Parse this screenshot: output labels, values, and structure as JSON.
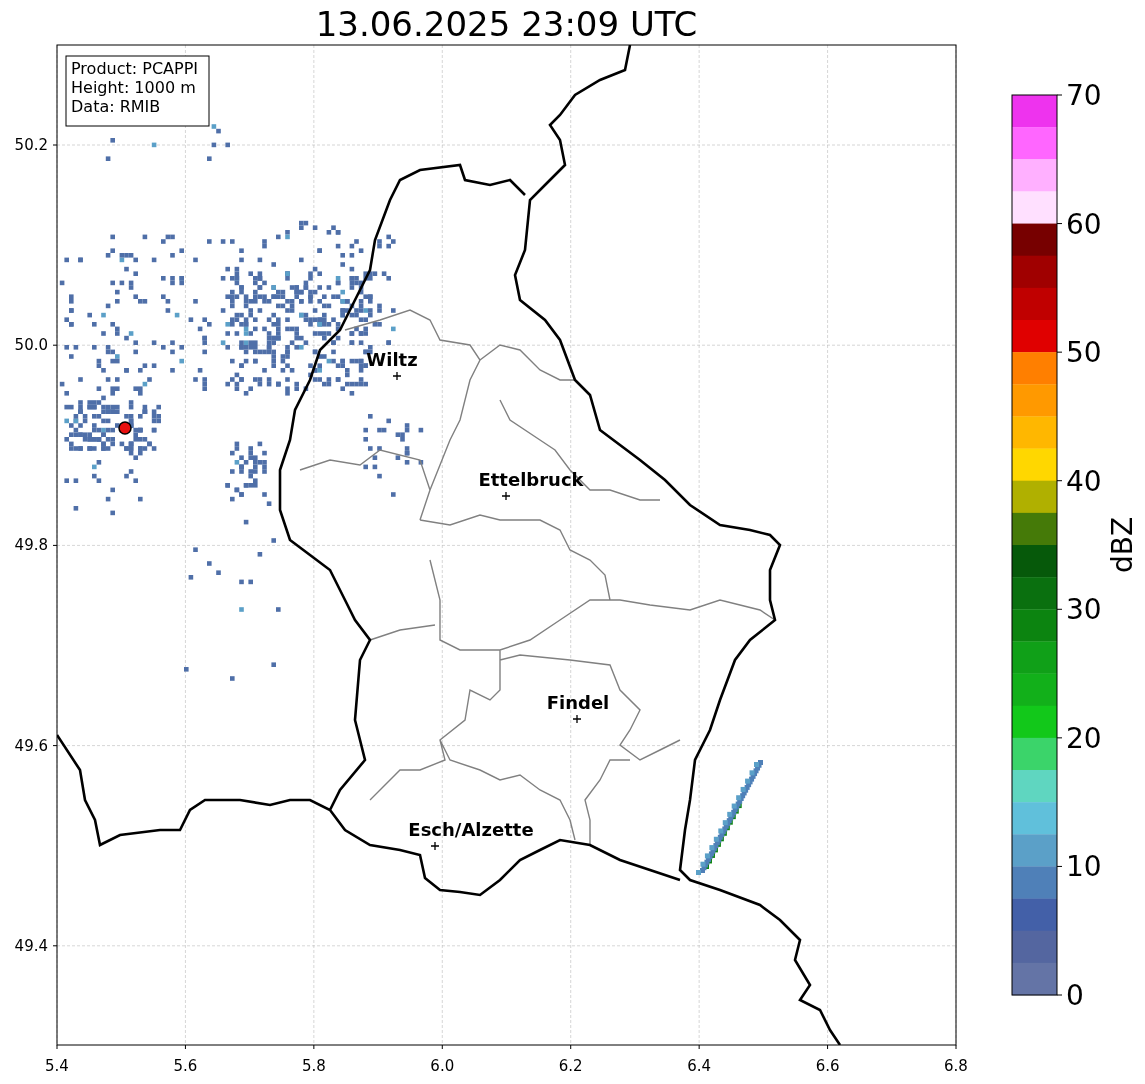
{
  "title": "13.06.2025 23:09 UTC",
  "info_box": [
    "Product: PCAPPI",
    "Height: 1000 m",
    "Data: RMIB"
  ],
  "axes": {
    "x_ticks": [
      "5.4",
      "5.6",
      "5.8",
      "6.0",
      "6.2",
      "6.4",
      "6.6",
      "6.8"
    ],
    "y_ticks": [
      "50.2",
      "50.0",
      "49.8",
      "49.6",
      "49.4"
    ]
  },
  "cities": [
    {
      "name": "Wiltz"
    },
    {
      "name": "Ettelbruck"
    },
    {
      "name": "Findel"
    },
    {
      "name": "Esch/Alzette"
    }
  ],
  "colorbar": {
    "label": "dBZ",
    "ticks": [
      "70",
      "60",
      "50",
      "40",
      "30",
      "20",
      "10",
      "0"
    ],
    "segments": [
      {
        "color": "#ee33ee"
      },
      {
        "color": "#ff66ff"
      },
      {
        "color": "#ffb0ff"
      },
      {
        "color": "#ffe0ff"
      },
      {
        "color": "#770000"
      },
      {
        "color": "#a00000"
      },
      {
        "color": "#c00000"
      },
      {
        "color": "#e00000"
      },
      {
        "color": "#ff7f00"
      },
      {
        "color": "#ff9900"
      },
      {
        "color": "#ffb700"
      },
      {
        "color": "#ffd700"
      },
      {
        "color": "#b0b000"
      },
      {
        "color": "#457a08"
      },
      {
        "color": "#06590a"
      },
      {
        "color": "#0a700f"
      },
      {
        "color": "#0c8410"
      },
      {
        "color": "#10a018"
      },
      {
        "color": "#12b01a"
      },
      {
        "color": "#12c81a"
      },
      {
        "color": "#3bd46a"
      },
      {
        "color": "#5fd6c0"
      },
      {
        "color": "#60c0db"
      },
      {
        "color": "#5ba0c8"
      },
      {
        "color": "#4f80b8"
      },
      {
        "color": "#4360a8"
      },
      {
        "color": "#5466a0"
      },
      {
        "color": "#6474a6"
      }
    ]
  }
}
